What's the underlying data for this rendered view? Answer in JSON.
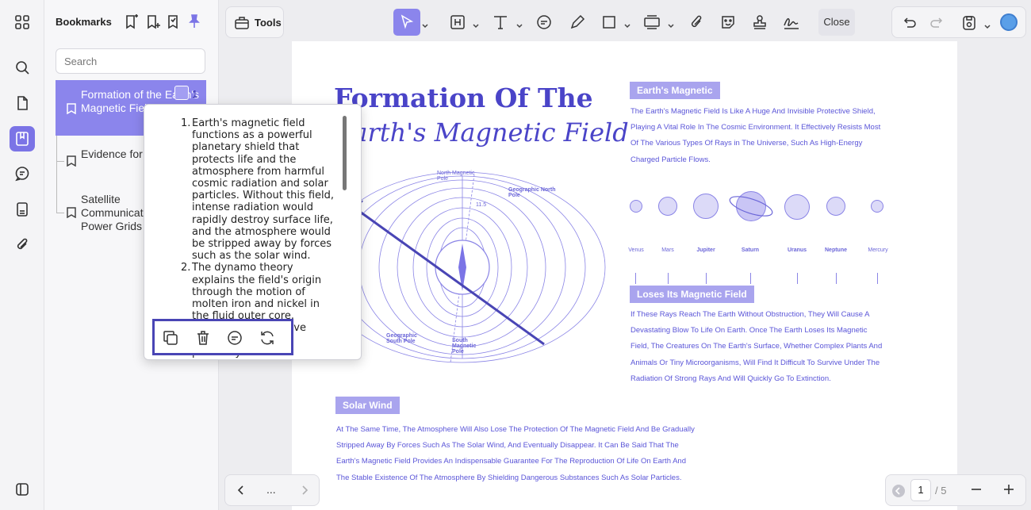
{
  "panel": {
    "title": "Bookmarks",
    "search_placeholder": "Search",
    "items": [
      {
        "label": "Formation of the Earth's Magnetic Field",
        "page": "1"
      },
      {
        "label": "Evidence for Theories"
      },
      {
        "label": "Satellite Communications and Power Grids"
      }
    ]
  },
  "toolbar": {
    "tools_label": "Tools",
    "close_label": "Close"
  },
  "popup": {
    "items": [
      "Earth's magnetic field functions as a powerful planetary shield that protects life and the atmosphere from harmful cosmic radiation and solar particles. Without this field, intense radiation would rapidly destroy surface life, and the atmosphere would be stripped away by forces such as the solar wind.",
      "The dynamo theory explains the field's origin through the motion of molten iron and nickel in the fluid outer core. Heated by radioactive decay and residual planetary heat"
    ]
  },
  "document": {
    "title_line1": "Formation Of The",
    "title_line2": "Earth's Magnetic Field",
    "diagram_labels": {
      "north_magnetic": "North Magnetic Pole",
      "geo_north": "Geographic North Pole",
      "geo_south": "Geographic South Pole",
      "south_magnetic": "South Magnetic Pole",
      "angle": "11.5"
    },
    "section1": {
      "heading": "Earth's Magnetic",
      "lines": [
        "The Earth's Magnetic Field Is Like A Huge And Invisible Protective Shield,",
        "Playing A Vital Role In The Cosmic Environment. It Effectively Resists Most",
        "Of The Various Types Of Rays in The Universe, Such As High-Energy",
        "Charged Particle Flows."
      ]
    },
    "planets": [
      "Venus",
      "Mars",
      "Jupiter",
      "Saturn",
      "Uranus",
      "Neptune",
      "Mercury"
    ],
    "section2": {
      "heading": "Loses Its Magnetic Field",
      "lines": [
        "If These Rays Reach The Earth Without Obstruction, They Will Cause A",
        "Devastating Blow To Life On Earth. Once The Earth Loses Its Magnetic",
        "Field, The Creatures On The Earth's Surface, Whether Complex Plants And",
        "Animals Or Tiny Microorganisms, Will Find It Difficult To Survive Under The",
        "Radiation Of Strong Rays And Will Quickly Go To Extinction."
      ]
    },
    "section3": {
      "heading": "Solar Wind",
      "lines": [
        "At The Same Time, The Atmosphere Will Also Lose The Protection Of The Magnetic Field And Be Gradually",
        "Stripped Away By Forces Such As The Solar Wind, And Eventually Disappear. It Can Be Said That The",
        "Earth's Magnetic Field Provides An Indispensable Guarantee For The Reproduction Of Life On Earth And",
        "The Stable Existence Of The Atmosphere By Shielding Dangerous Substances Such As Solar Particles."
      ]
    }
  },
  "pager": {
    "ellipsis": "...",
    "current_page": "1",
    "total": "/ 5"
  },
  "colors": {
    "accent": "#7b74e6",
    "doc_text": "#5a55d8",
    "highlight_border": "#4945b5"
  }
}
